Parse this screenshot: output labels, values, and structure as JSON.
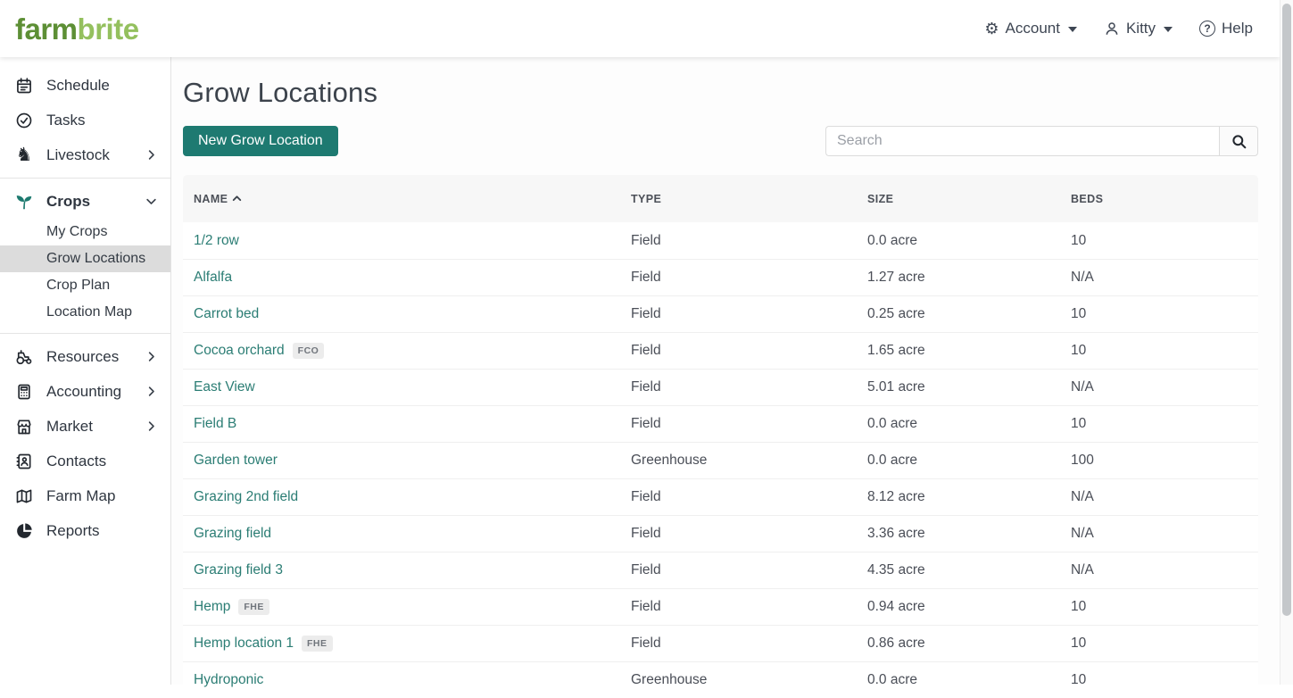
{
  "header": {
    "logo_part1": "farm",
    "logo_part2": "brite",
    "account_label": "Account",
    "user_label": "Kitty",
    "help_label": "Help",
    "help_glyph": "?",
    "gear_glyph": "⚙"
  },
  "sidebar": {
    "items": [
      {
        "label": "Schedule",
        "icon": "calendar-icon"
      },
      {
        "label": "Tasks",
        "icon": "task-check-icon"
      },
      {
        "label": "Livestock",
        "icon": "horse-icon",
        "chevron": "right"
      },
      {
        "label": "Crops",
        "icon": "seedling-icon",
        "chevron": "down",
        "bold": true,
        "group": true,
        "children": [
          {
            "label": "My Crops",
            "active": false
          },
          {
            "label": "Grow Locations",
            "active": true
          },
          {
            "label": "Crop Plan",
            "active": false
          },
          {
            "label": "Location Map",
            "active": false
          }
        ]
      },
      {
        "label": "Resources",
        "icon": "tractor-icon",
        "chevron": "right"
      },
      {
        "label": "Accounting",
        "icon": "calculator-icon",
        "chevron": "right"
      },
      {
        "label": "Market",
        "icon": "store-icon",
        "chevron": "right"
      },
      {
        "label": "Contacts",
        "icon": "address-book-icon"
      },
      {
        "label": "Farm Map",
        "icon": "map-icon"
      },
      {
        "label": "Reports",
        "icon": "pie-chart-icon"
      }
    ]
  },
  "main": {
    "title": "Grow Locations",
    "new_button_label": "New Grow Location",
    "search": {
      "placeholder": "Search"
    },
    "table": {
      "columns": [
        {
          "key": "name",
          "label": "NAME",
          "sorted": "asc"
        },
        {
          "key": "type",
          "label": "TYPE"
        },
        {
          "key": "size",
          "label": "SIZE"
        },
        {
          "key": "beds",
          "label": "BEDS"
        }
      ],
      "rows": [
        {
          "name": "1/2 row",
          "badge": "",
          "type": "Field",
          "size": "0.0 acre",
          "beds": "10"
        },
        {
          "name": "Alfalfa",
          "badge": "",
          "type": "Field",
          "size": "1.27 acre",
          "beds": "N/A"
        },
        {
          "name": "Carrot bed",
          "badge": "",
          "type": "Field",
          "size": "0.25 acre",
          "beds": "10"
        },
        {
          "name": "Cocoa orchard",
          "badge": "FCO",
          "type": "Field",
          "size": "1.65 acre",
          "beds": "10"
        },
        {
          "name": "East View",
          "badge": "",
          "type": "Field",
          "size": "5.01 acre",
          "beds": "N/A"
        },
        {
          "name": "Field B",
          "badge": "",
          "type": "Field",
          "size": "0.0 acre",
          "beds": "10"
        },
        {
          "name": "Garden tower",
          "badge": "",
          "type": "Greenhouse",
          "size": "0.0 acre",
          "beds": "100"
        },
        {
          "name": "Grazing 2nd field",
          "badge": "",
          "type": "Field",
          "size": "8.12 acre",
          "beds": "N/A"
        },
        {
          "name": "Grazing field",
          "badge": "",
          "type": "Field",
          "size": "3.36 acre",
          "beds": "N/A"
        },
        {
          "name": "Grazing field 3",
          "badge": "",
          "type": "Field",
          "size": "4.35 acre",
          "beds": "N/A"
        },
        {
          "name": "Hemp",
          "badge": "FHE",
          "type": "Field",
          "size": "0.94 acre",
          "beds": "10"
        },
        {
          "name": "Hemp location 1",
          "badge": "FHE",
          "type": "Field",
          "size": "0.86 acre",
          "beds": "10"
        },
        {
          "name": "Hydroponic",
          "badge": "",
          "type": "Greenhouse",
          "size": "0.0 acre",
          "beds": "10"
        }
      ]
    }
  },
  "colors": {
    "accent_teal": "#1e7a71",
    "link_teal": "#2b7d74",
    "seedling_teal": "#1d7a6f",
    "logo_dark_green": "#5d8f35",
    "logo_light_green": "#94c05e",
    "active_item_bg": "#dcdcdc",
    "text_dark": "#3c434c"
  }
}
